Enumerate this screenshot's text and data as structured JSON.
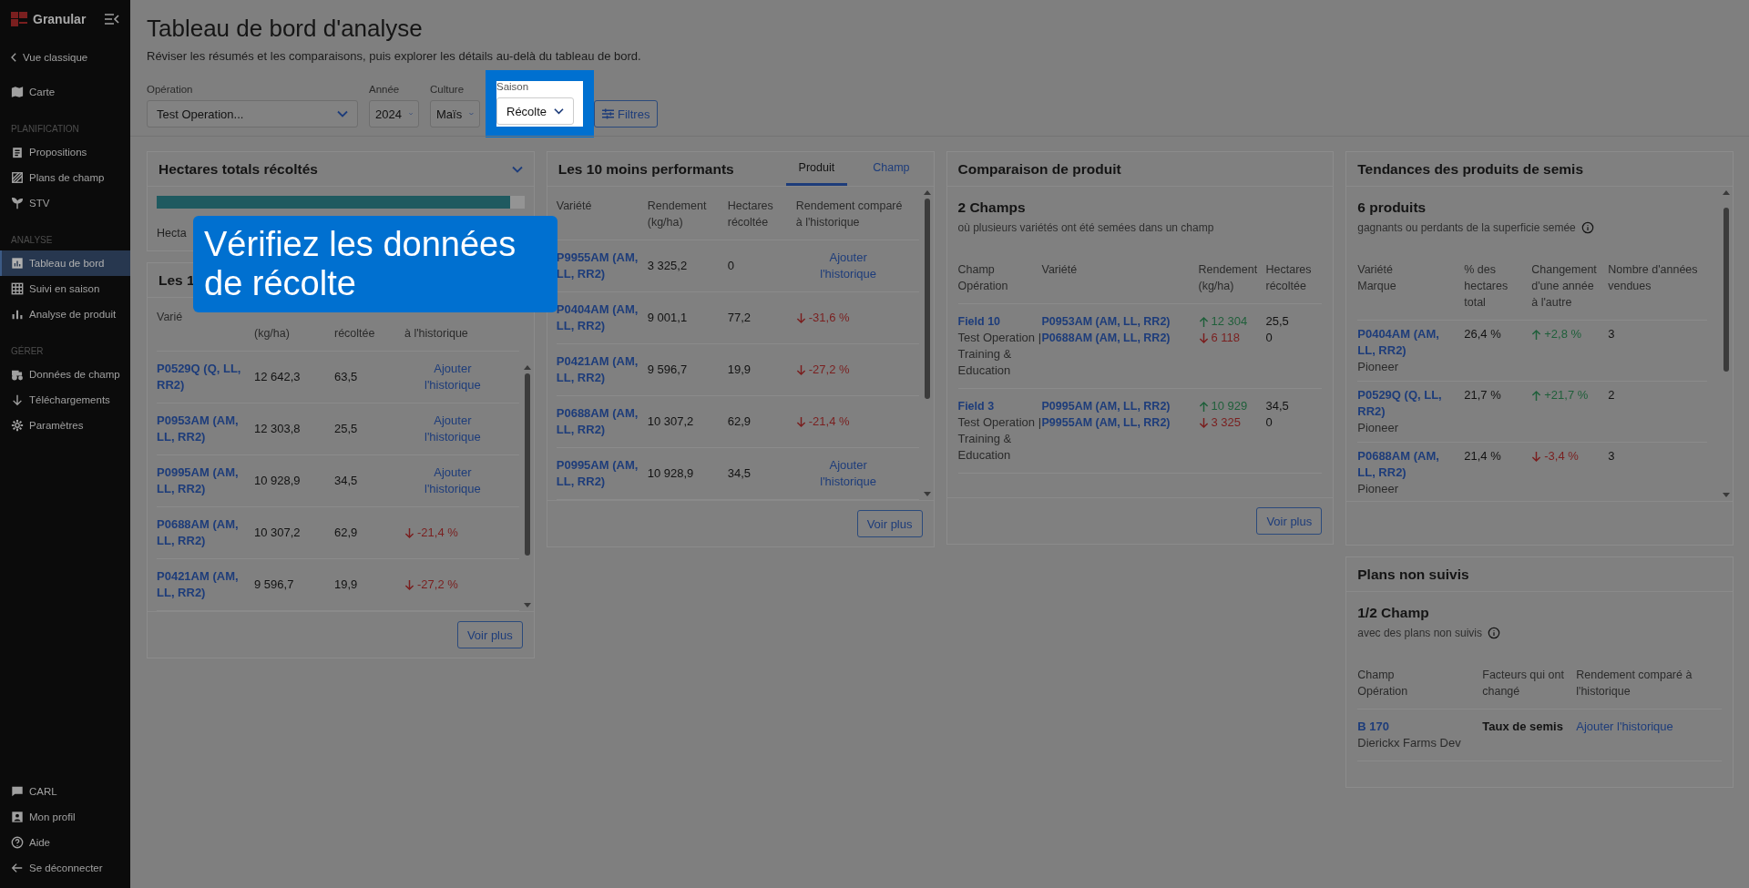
{
  "sidebar": {
    "brand": "Granular",
    "back_link": "Vue classique",
    "groups": [
      {
        "items": [
          {
            "label": "Carte",
            "selected": false
          }
        ]
      },
      {
        "title": "PLANIFICATION",
        "items": [
          {
            "label": "Propositions",
            "selected": false
          },
          {
            "label": "Plans de champ",
            "selected": false
          },
          {
            "label": "STV",
            "selected": false
          }
        ]
      },
      {
        "title": "ANALYSE",
        "items": [
          {
            "label": "Tableau de bord",
            "selected": true
          },
          {
            "label": "Suivi en saison",
            "selected": false
          },
          {
            "label": "Analyse de produit",
            "selected": false
          }
        ]
      },
      {
        "title": "GÉRER",
        "items": [
          {
            "label": "Données de champ",
            "selected": false
          },
          {
            "label": "Téléchargements",
            "selected": false
          },
          {
            "label": "Paramètres",
            "selected": false
          }
        ]
      }
    ],
    "footer_items": [
      "CARL",
      "Mon profil",
      "Aide",
      "Se déconnecter"
    ]
  },
  "page": {
    "title": "Tableau de bord d'analyse",
    "subtitle": "Réviser les résumés et les comparaisons, puis explorer les détails au-delà du tableau de bord."
  },
  "filters": [
    {
      "label": "Opération",
      "value": "Test Operation...",
      "highlighted": false
    },
    {
      "label": "Année",
      "value": "2024",
      "highlighted": false
    },
    {
      "label": "Culture",
      "value": "Maïs",
      "highlighted": false
    },
    {
      "label": "Saison",
      "value": "Récolte",
      "highlighted": true
    }
  ],
  "filters_button": "Filtres",
  "callout": {
    "text": "Vérifiez les données de récolte"
  },
  "hectares_card": {
    "title": "Hectares totals récoltés",
    "level": 0.96,
    "label": "Hecta"
  },
  "top_card": {
    "title": "Les 1",
    "columns": [
      "Varié",
      "(kg/ha)",
      "récoltée",
      "à l'historique"
    ],
    "rows": [
      {
        "variety": "P0529Q (Q, LL, RR2)",
        "yield": "12 642,3",
        "hectares": "63,5",
        "comparison": {
          "kind": "link",
          "text": "Ajouter l'historique"
        }
      },
      {
        "variety": "P0953AM (AM, LL, RR2)",
        "yield": "12 303,8",
        "hectares": "25,5",
        "comparison": {
          "kind": "link",
          "text": "Ajouter l'historique"
        }
      },
      {
        "variety": "P0995AM (AM, LL, RR2)",
        "yield": "10 928,9",
        "hectares": "34,5",
        "comparison": {
          "kind": "link",
          "text": "Ajouter l'historique"
        }
      },
      {
        "variety": "P0688AM (AM, LL, RR2)",
        "yield": "10 307,2",
        "hectares": "62,9",
        "comparison": {
          "kind": "change",
          "rising": false,
          "text": "-21,4 %"
        }
      },
      {
        "variety": "P0421AM (AM, LL, RR2)",
        "yield": "9 596,7",
        "hectares": "19,9",
        "comparison": {
          "kind": "change",
          "rising": false,
          "text": "-27,2 %"
        }
      }
    ],
    "button": "Voir plus"
  },
  "worst_card": {
    "title": "Les 10 moins performants",
    "tabs": [
      {
        "label": "Produit",
        "selected": true
      },
      {
        "label": "Champ",
        "selected": false
      }
    ],
    "columns": [
      "Variété",
      "Rendement (kg/ha)",
      "Hectares récoltée",
      "Rendement comparé à l'historique"
    ],
    "rows": [
      {
        "variety": "P9955AM (AM, LL, RR2)",
        "yield": "3 325,2",
        "hectares": "0",
        "comparison": {
          "kind": "link",
          "text": "Ajouter l'historique"
        }
      },
      {
        "variety": "P0404AM (AM, LL, RR2)",
        "yield": "9 001,1",
        "hectares": "77,2",
        "comparison": {
          "kind": "change",
          "rising": false,
          "text": "-31,6 %"
        }
      },
      {
        "variety": "P0421AM (AM, LL, RR2)",
        "yield": "9 596,7",
        "hectares": "19,9",
        "comparison": {
          "kind": "change",
          "rising": false,
          "text": "-27,2 %"
        }
      },
      {
        "variety": "P0688AM (AM, LL, RR2)",
        "yield": "10 307,2",
        "hectares": "62,9",
        "comparison": {
          "kind": "change",
          "rising": false,
          "text": "-21,4 %"
        }
      },
      {
        "variety": "P0995AM (AM, LL, RR2)",
        "yield": "10 928,9",
        "hectares": "34,5",
        "comparison": {
          "kind": "link",
          "text": "Ajouter l'historique"
        }
      }
    ],
    "button": "Voir plus"
  },
  "comparison_card": {
    "title": "Comparaison de produit",
    "summary": "2 Champs",
    "description": "où plusieurs variétés ont été semées dans un champ",
    "columns": [
      {
        "label": "Champ",
        "sublabel": "Opération"
      },
      {
        "label": "Variété"
      },
      {
        "label": "Rendement (kg/ha)"
      },
      {
        "label": "Hectares récoltée"
      }
    ],
    "rows": [
      {
        "field": "Field 10",
        "operation": "Test Operation | Training & Education",
        "varieties": [
          {
            "name": "P0953AM (AM, LL, RR2)",
            "rising": true,
            "yield": "12 304",
            "hectares": "25,5"
          },
          {
            "name": "P0688AM (AM, LL, RR2)",
            "rising": false,
            "yield": "6 118",
            "hectares": "0"
          }
        ]
      },
      {
        "field": "Field 3",
        "operation": "Test Operation | Training & Education",
        "varieties": [
          {
            "name": "P0995AM (AM, LL, RR2)",
            "rising": true,
            "yield": "10 929",
            "hectares": "34,5"
          },
          {
            "name": "P9955AM (AM, LL, RR2)",
            "rising": false,
            "yield": "3 325",
            "hectares": "0"
          }
        ]
      }
    ],
    "button": "Voir plus"
  },
  "trends_card": {
    "title": "Tendances des produits de semis",
    "summary": "6 produits",
    "description": "gagnants ou perdants de la superficie semée",
    "columns": [
      {
        "label": "Variété",
        "sublabel": "Marque"
      },
      {
        "label": "% des hectares total"
      },
      {
        "label": "Changement d'une année à l'autre"
      },
      {
        "label": "Nombre d'années vendues"
      }
    ],
    "rows": [
      {
        "variety": "P0404AM (AM, LL, RR2)",
        "brand": "Pioneer",
        "share": "26,4 %",
        "rising": true,
        "change": "+2,8 %",
        "years": "3"
      },
      {
        "variety": "P0529Q (Q, LL, RR2)",
        "brand": "Pioneer",
        "share": "21,7 %",
        "rising": true,
        "change": "+21,7 %",
        "years": "2"
      },
      {
        "variety": "P0688AM (AM, LL, RR2)",
        "brand": "Pioneer",
        "share": "21,4 %",
        "rising": false,
        "change": "-3,4 %",
        "years": "3"
      }
    ]
  },
  "plans_card": {
    "title": "Plans non suivis",
    "summary": "1/2 Champ",
    "description": "avec des plans non suivis",
    "columns": [
      {
        "label": "Champ",
        "sublabel": "Opération"
      },
      {
        "label": "Facteurs qui ont changé"
      },
      {
        "label": "Rendement comparé à l'historique"
      }
    ],
    "rows": [
      {
        "field": "B 170",
        "operation": "Dierickx Farms Dev",
        "factor": "Taux de semis",
        "comparison": "Ajouter l'historique"
      }
    ]
  }
}
